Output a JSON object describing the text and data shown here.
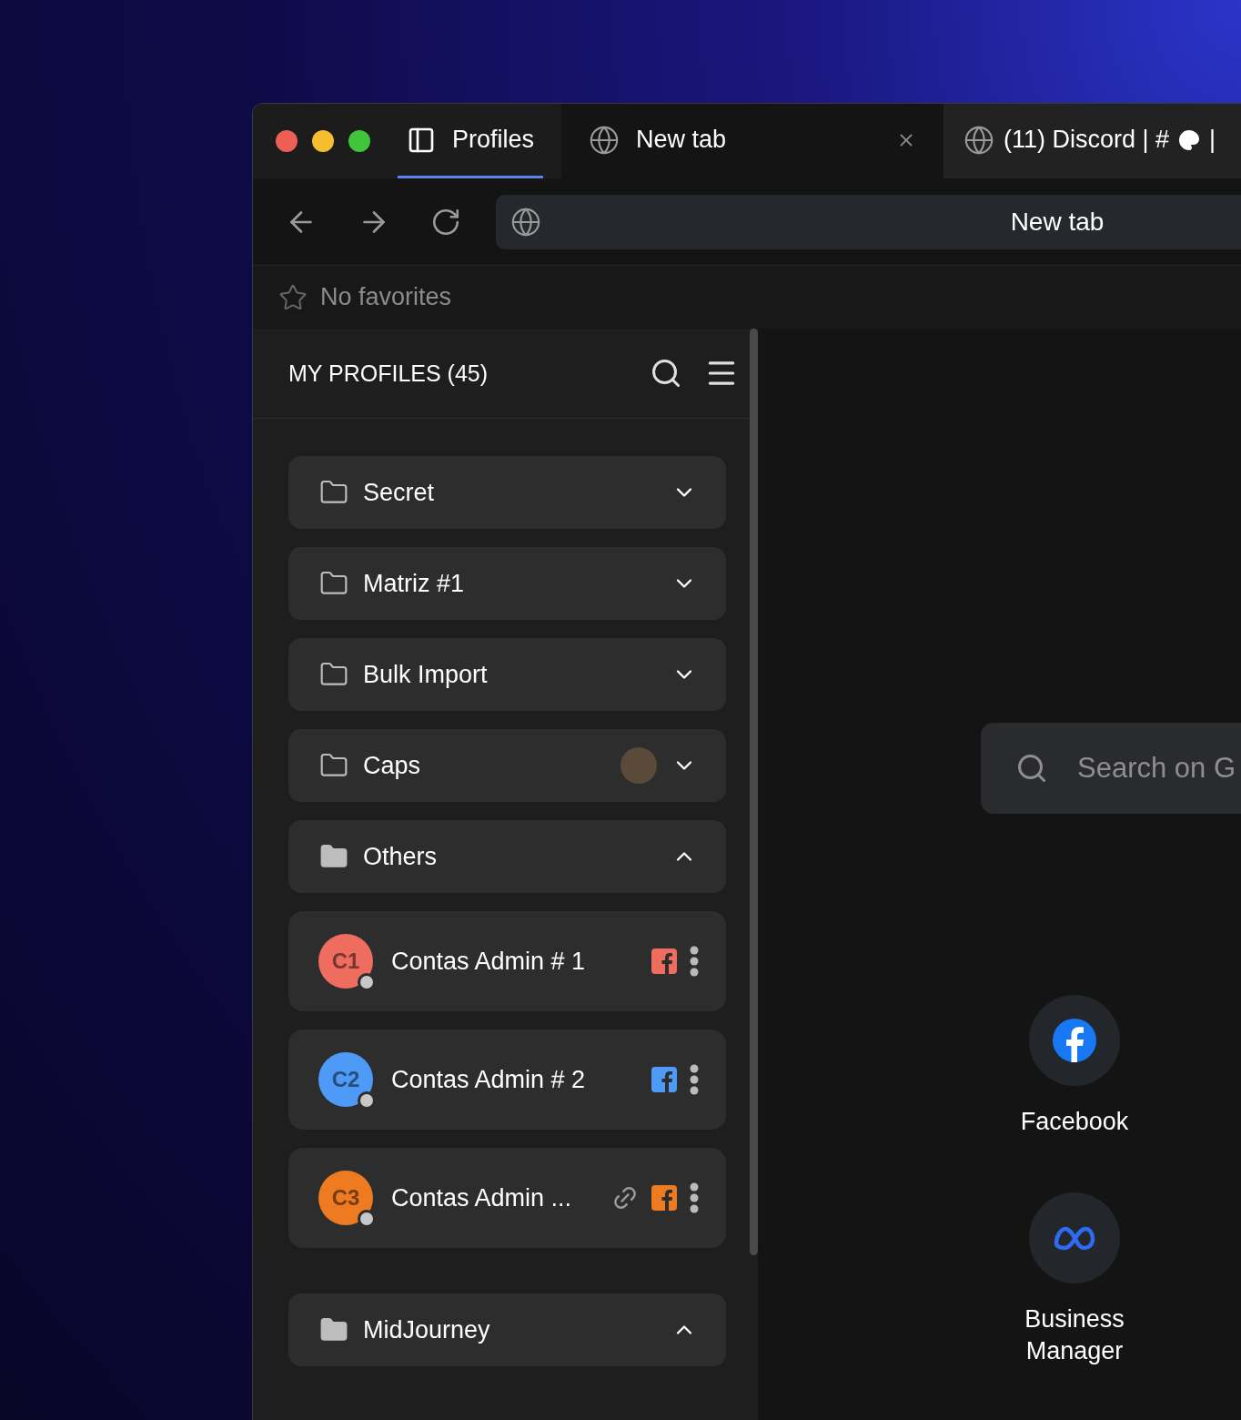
{
  "tabs": [
    {
      "kind": "panel",
      "label": "Profiles",
      "selected": true,
      "active": false,
      "closable": false
    },
    {
      "kind": "page",
      "label": "New tab",
      "selected": false,
      "active": true,
      "closable": true
    },
    {
      "kind": "page",
      "label": "(11) Discord | #",
      "tail": "|",
      "selected": false,
      "active": false,
      "closable": false
    }
  ],
  "address_bar": {
    "value": "New tab"
  },
  "favorites_bar": {
    "text": "No favorites"
  },
  "sidebar": {
    "title": "MY PROFILES (45)",
    "folders": [
      {
        "name": "Secret",
        "expanded": false,
        "has_avatar": false
      },
      {
        "name": "Matriz #1",
        "expanded": false,
        "has_avatar": false
      },
      {
        "name": "Bulk Import",
        "expanded": false,
        "has_avatar": false
      },
      {
        "name": "Caps",
        "expanded": false,
        "has_avatar": true
      },
      {
        "name": "Others",
        "expanded": true,
        "has_avatar": false,
        "children": [
          {
            "initials": "C1",
            "name": "Contas Admin # 1",
            "color": "#ee6d5e",
            "linked": false
          },
          {
            "initials": "C2",
            "name": "Contas Admin # 2",
            "color": "#4d9bf7",
            "linked": false
          },
          {
            "initials": "C3",
            "name": "Contas Admin ...",
            "color": "#ee7a22",
            "linked": true
          }
        ]
      },
      {
        "name": "MidJourney",
        "expanded": true,
        "has_avatar": false
      }
    ]
  },
  "content": {
    "search": {
      "placeholder": "Search on G"
    },
    "shortcuts": [
      {
        "kind": "facebook",
        "label": "Facebook"
      },
      {
        "kind": "meta",
        "label": "Business Manager"
      }
    ]
  }
}
